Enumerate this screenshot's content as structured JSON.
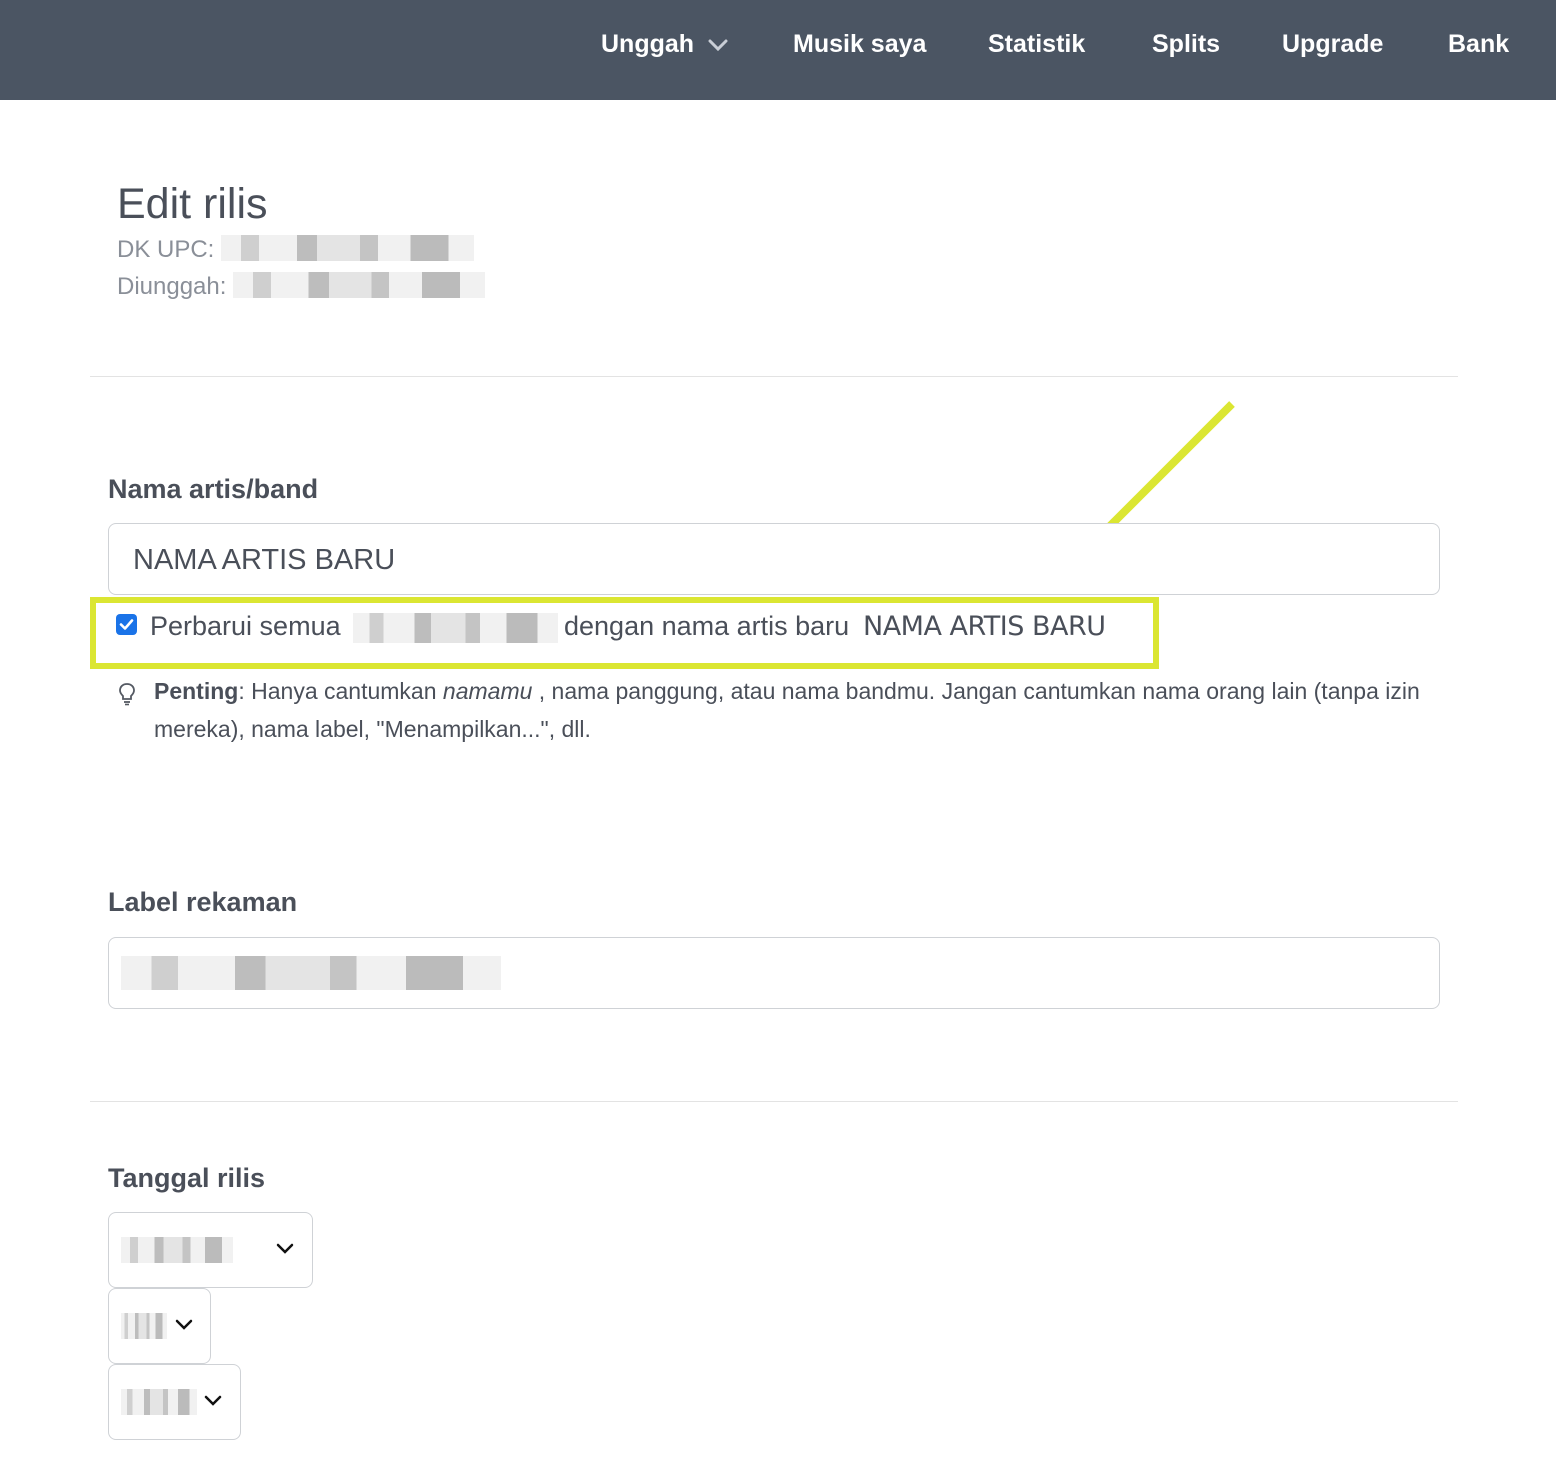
{
  "nav": {
    "items": [
      {
        "label": "Unggah"
      },
      {
        "label": "Musik saya"
      },
      {
        "label": "Statistik"
      },
      {
        "label": "Splits"
      },
      {
        "label": "Upgrade"
      },
      {
        "label": "Bank"
      }
    ]
  },
  "header": {
    "title": "Edit rilis",
    "upc_label": "DK UPC:",
    "uploaded_label": "Diunggah:"
  },
  "artist": {
    "label": "Nama artis/band",
    "value": "NAMA ARTIS BARU",
    "update_checked": true,
    "update_prefix": "Perbarui semua",
    "update_middle": "dengan nama artis baru",
    "update_name": "NAMA ARTIS BARU",
    "tip_bold": "Penting",
    "tip_part1": ": Hanya cantumkan ",
    "tip_em": "namamu",
    "tip_part2": " , nama panggung, atau nama bandmu. Jangan cantumkan nama orang lain (tanpa izin mereka), nama label, \"Menampilkan...\", dll."
  },
  "label_section": {
    "label": "Label rekaman"
  },
  "release_date": {
    "label": "Tanggal rilis"
  },
  "colors": {
    "topbar": "#4b5563",
    "highlight": "#dbe632",
    "checkbox": "#1a73e8"
  }
}
